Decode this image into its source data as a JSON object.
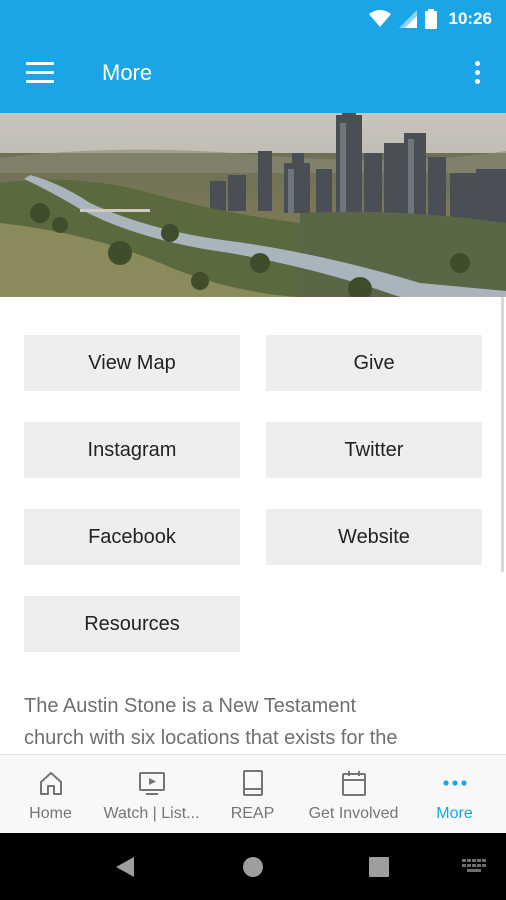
{
  "status_bar": {
    "time": "10:26",
    "icons": [
      "wifi-icon",
      "cell-signal-icon",
      "battery-icon"
    ]
  },
  "app_bar": {
    "title": "More",
    "menu_icon": "hamburger-menu-icon",
    "overflow_icon": "overflow-menu-icon"
  },
  "hero": {
    "description_icon": "city-skyline-image"
  },
  "buttons": [
    {
      "label": "View Map"
    },
    {
      "label": "Give"
    },
    {
      "label": "Instagram"
    },
    {
      "label": "Twitter"
    },
    {
      "label": "Facebook"
    },
    {
      "label": "Website"
    },
    {
      "label": "Resources"
    }
  ],
  "description": {
    "line1": "The Austin Stone is a New Testament",
    "line2": "church with six locations that exists for the"
  },
  "bottom_nav": {
    "items": [
      {
        "label": "Home",
        "icon": "home-icon",
        "active": false
      },
      {
        "label": "Watch | List...",
        "icon": "video-player-icon",
        "active": false
      },
      {
        "label": "REAP",
        "icon": "book-icon",
        "active": false
      },
      {
        "label": "Get Involved",
        "icon": "calendar-icon",
        "active": false
      },
      {
        "label": "More",
        "icon": "more-dots-icon",
        "active": true
      }
    ]
  },
  "system_nav": {
    "icons": [
      "back-icon",
      "home-circle-icon",
      "recents-icon",
      "keyboard-icon"
    ]
  },
  "colors": {
    "primary": "#1aa5e6",
    "button_bg": "#eceeef",
    "text_muted": "#6f6f6f"
  }
}
